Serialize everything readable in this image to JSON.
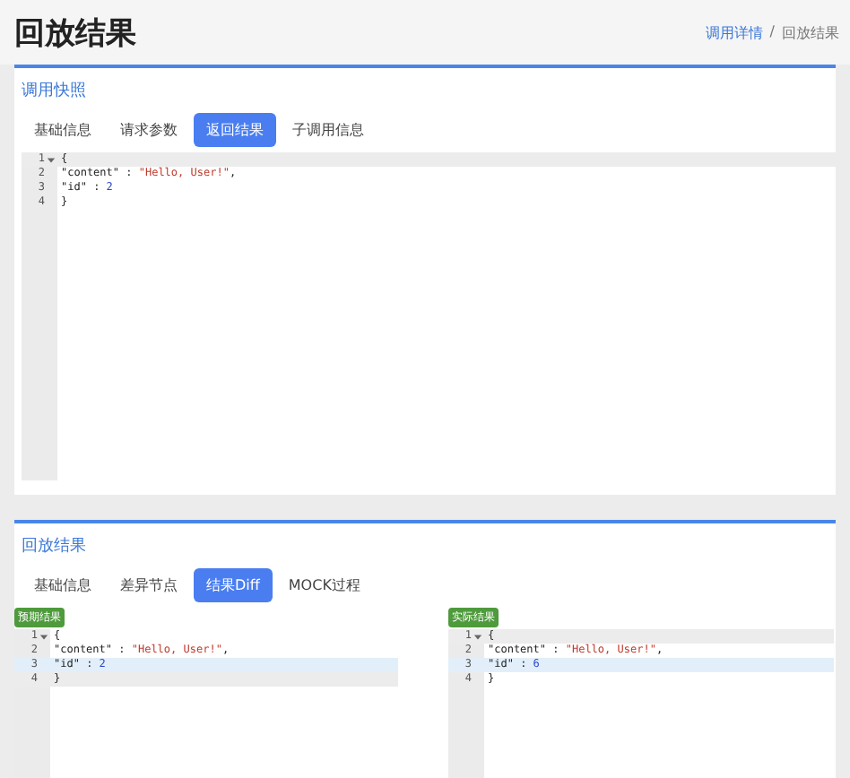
{
  "page_title": "回放结果",
  "breadcrumb": [
    {
      "label": "调用详情",
      "link": true
    },
    {
      "label": "/",
      "link": false
    },
    {
      "label": "回放结果",
      "link": false
    }
  ],
  "snapshot": {
    "title": "调用快照",
    "tabs": [
      {
        "label": "基础信息",
        "selected": false
      },
      {
        "label": "请求参数",
        "selected": false
      },
      {
        "label": "返回结果",
        "selected": true
      },
      {
        "label": "子调用信息",
        "selected": false
      }
    ],
    "editor": {
      "lines": [
        {
          "number": "1",
          "fold": true,
          "active": true,
          "changed": false,
          "tokens": [
            {
              "kind": "punct",
              "text": "{"
            }
          ]
        },
        {
          "number": "2",
          "fold": false,
          "active": false,
          "changed": false,
          "tokens": [
            {
              "kind": "key",
              "text": "\"content\""
            },
            {
              "kind": "punct",
              "text": " : "
            },
            {
              "kind": "string",
              "text": "\"Hello, User!\""
            },
            {
              "kind": "punct",
              "text": ","
            }
          ]
        },
        {
          "number": "3",
          "fold": false,
          "active": false,
          "changed": false,
          "tokens": [
            {
              "kind": "key",
              "text": "\"id\""
            },
            {
              "kind": "punct",
              "text": " : "
            },
            {
              "kind": "number",
              "text": "2"
            }
          ]
        },
        {
          "number": "4",
          "fold": false,
          "active": false,
          "changed": false,
          "tokens": [
            {
              "kind": "punct",
              "text": "}"
            }
          ]
        }
      ]
    }
  },
  "replay": {
    "title": "回放结果",
    "tabs": [
      {
        "label": "基础信息",
        "selected": false
      },
      {
        "label": "差异节点",
        "selected": false
      },
      {
        "label": "结果Diff",
        "selected": true
      },
      {
        "label": "MOCK过程",
        "selected": false
      }
    ],
    "panels": [
      {
        "badge": "预期结果",
        "lines": [
          {
            "number": "1",
            "fold": true,
            "active": false,
            "changed": false,
            "tokens": [
              {
                "kind": "punct",
                "text": "{"
              }
            ]
          },
          {
            "number": "2",
            "fold": false,
            "active": false,
            "changed": false,
            "tokens": [
              {
                "kind": "key",
                "text": "\"content\""
              },
              {
                "kind": "punct",
                "text": " : "
              },
              {
                "kind": "string",
                "text": "\"Hello, User!\""
              },
              {
                "kind": "punct",
                "text": ","
              }
            ]
          },
          {
            "number": "3",
            "fold": false,
            "active": false,
            "changed": true,
            "tokens": [
              {
                "kind": "key",
                "text": "\"id\""
              },
              {
                "kind": "punct",
                "text": " : "
              },
              {
                "kind": "number",
                "text": "2"
              }
            ]
          },
          {
            "number": "4",
            "fold": false,
            "active": true,
            "changed": false,
            "tokens": [
              {
                "kind": "punct",
                "text": "}"
              }
            ]
          }
        ]
      },
      {
        "badge": "实际结果",
        "lines": [
          {
            "number": "1",
            "fold": true,
            "active": true,
            "changed": false,
            "tokens": [
              {
                "kind": "punct",
                "text": "{"
              }
            ]
          },
          {
            "number": "2",
            "fold": false,
            "active": false,
            "changed": false,
            "tokens": [
              {
                "kind": "key",
                "text": "\"content\""
              },
              {
                "kind": "punct",
                "text": " : "
              },
              {
                "kind": "string",
                "text": "\"Hello, User!\""
              },
              {
                "kind": "punct",
                "text": ","
              }
            ]
          },
          {
            "number": "3",
            "fold": false,
            "active": false,
            "changed": true,
            "tokens": [
              {
                "kind": "key",
                "text": "\"id\""
              },
              {
                "kind": "punct",
                "text": " : "
              },
              {
                "kind": "number",
                "text": "6"
              }
            ]
          },
          {
            "number": "4",
            "fold": false,
            "active": false,
            "changed": false,
            "tokens": [
              {
                "kind": "punct",
                "text": "}"
              }
            ]
          }
        ]
      }
    ]
  }
}
